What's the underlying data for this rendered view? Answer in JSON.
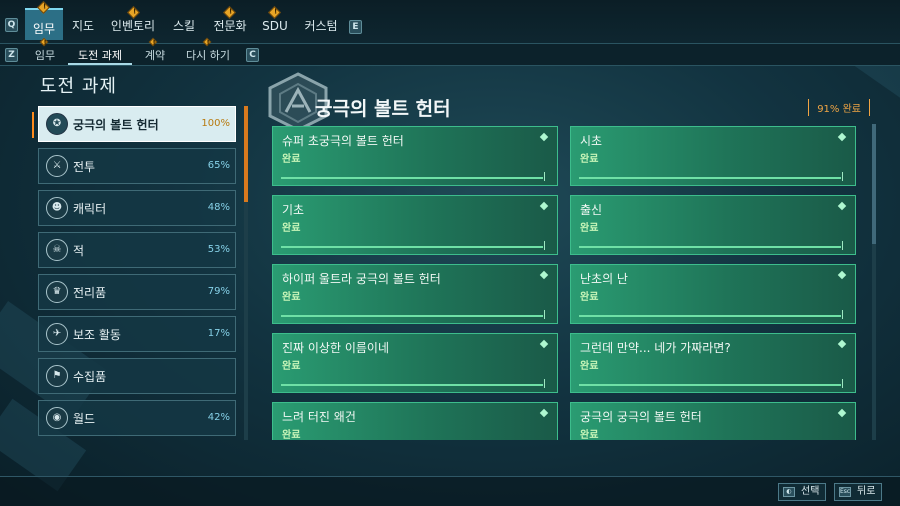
{
  "nav": {
    "left_key": "Q",
    "right_key": "E",
    "tabs": [
      {
        "label": "임무",
        "alert": true
      },
      {
        "label": "지도",
        "alert": false
      },
      {
        "label": "인벤토리",
        "alert": true
      },
      {
        "label": "스킬",
        "alert": false
      },
      {
        "label": "전문화",
        "alert": true
      },
      {
        "label": "SDU",
        "alert": true
      },
      {
        "label": "커스텀",
        "alert": false
      }
    ]
  },
  "subnav": {
    "left_key": "Z",
    "right_key": "C",
    "tabs": [
      {
        "label": "임무"
      },
      {
        "label": "도전 과제"
      },
      {
        "label": "계약"
      },
      {
        "label": "다시 하기"
      }
    ]
  },
  "page_title": "도전 과제",
  "categories": [
    {
      "label": "궁극의 볼트 헌터",
      "pct": "100%",
      "icon": "vault-hunter-icon",
      "glyph": "✪"
    },
    {
      "label": "전투",
      "pct": "65%",
      "icon": "gun-icon",
      "glyph": "⚔"
    },
    {
      "label": "캐릭터",
      "pct": "48%",
      "icon": "character-icon",
      "glyph": "☻"
    },
    {
      "label": "적",
      "pct": "53%",
      "icon": "enemy-icon",
      "glyph": "☠"
    },
    {
      "label": "전리품",
      "pct": "79%",
      "icon": "loot-icon",
      "glyph": "♛"
    },
    {
      "label": "보조 활동",
      "pct": "17%",
      "icon": "side-activity-icon",
      "glyph": "✈"
    },
    {
      "label": "수집품",
      "pct": "",
      "icon": "collectible-icon",
      "glyph": "⚑"
    },
    {
      "label": "월드",
      "pct": "42%",
      "icon": "world-icon",
      "glyph": "◉"
    }
  ],
  "section": {
    "title": "궁극의 볼트 헌터",
    "completion": "91% 완료"
  },
  "challenges": [
    {
      "title": "슈퍼 초궁극의 볼트 헌터",
      "status": "완료"
    },
    {
      "title": "시초",
      "status": "완료"
    },
    {
      "title": "기초",
      "status": "완료"
    },
    {
      "title": "출신",
      "status": "완료"
    },
    {
      "title": "하이퍼 울트라 궁극의 볼트 헌터",
      "status": "완료"
    },
    {
      "title": "난초의 난",
      "status": "완료"
    },
    {
      "title": "진짜 이상한 이름이네",
      "status": "완료"
    },
    {
      "title": "그런데 만약... 네가 가짜라면?",
      "status": "완료"
    },
    {
      "title": "느려 터진 왜건",
      "status": "완료"
    },
    {
      "title": "궁극의 궁극의 볼트 헌터",
      "status": "완료"
    }
  ],
  "footer": {
    "select_key": "◐",
    "select_label": "선택",
    "back_key": "Esc",
    "back_label": "뒤로"
  },
  "colors": {
    "accent_orange": "#e8a526",
    "card_green": "#2a9c72",
    "nav_active": "#2c6f86"
  }
}
